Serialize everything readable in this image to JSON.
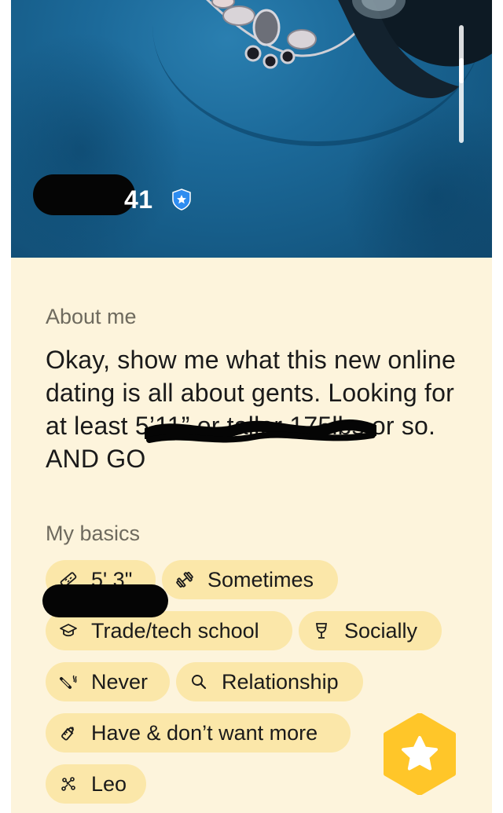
{
  "profile": {
    "age": "41",
    "verified_icon": "verified-badge-icon"
  },
  "about": {
    "label": "About me",
    "bio": "Okay, show me what this new online dating is all about gents. Looking for at least 5’11” or taller 175lbs or so. AND GO"
  },
  "basics": {
    "label": "My basics",
    "items": [
      {
        "icon": "ruler-icon",
        "label": "5' 3\""
      },
      {
        "icon": "dumbbell-icon",
        "label": "Sometimes"
      },
      {
        "icon": "graduation-cap-icon",
        "label": "Trade/tech school"
      },
      {
        "icon": "wine-glass-icon",
        "label": "Socially"
      },
      {
        "icon": "cigarette-icon",
        "label": "Never"
      },
      {
        "icon": "magnifier-icon",
        "label": "Relationship"
      },
      {
        "icon": "baby-bottle-icon",
        "label": "Have & don’t want more"
      },
      {
        "icon": "zodiac-icon",
        "label": "Leo"
      }
    ]
  },
  "colors": {
    "card_background": "#fdf4dc",
    "chip_background": "#fbe7a9",
    "accent_yellow": "#ffc629",
    "verified_blue": "#2e8cf0",
    "shirt_blue": "#1c6a9a"
  },
  "actions": {
    "superswipe_icon": "star-icon"
  }
}
